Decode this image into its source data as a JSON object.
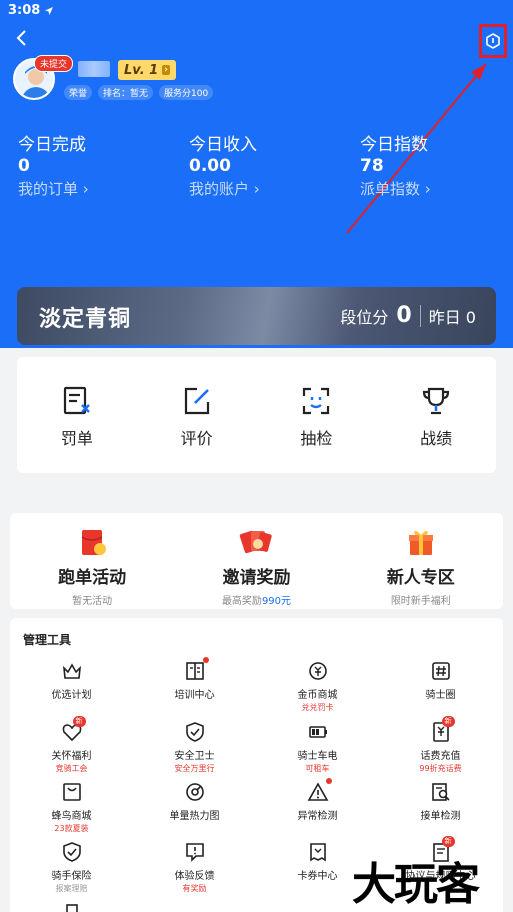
{
  "status_bar": {
    "time": "3:08"
  },
  "profile": {
    "badge": "未提交",
    "level": "Lv. 1",
    "meta": [
      "荣誉",
      "排名：暂无",
      "服务分100"
    ]
  },
  "stats": [
    {
      "label": "今日完成",
      "value": "0",
      "link": "我的订单 ›"
    },
    {
      "label": "今日收入",
      "value": "0.00",
      "link": "我的账户 ›"
    },
    {
      "label": "今日指数",
      "value": "78",
      "link": "派单指数 ›"
    }
  ],
  "rank": {
    "title": "淡定青铜",
    "score_label": "段位分",
    "score": "0",
    "yesterday": "昨日 0"
  },
  "quick_actions": [
    {
      "label": "罚单",
      "icon": "ticket-icon"
    },
    {
      "label": "评价",
      "icon": "edit-icon"
    },
    {
      "label": "抽检",
      "icon": "scan-face-icon"
    },
    {
      "label": "战绩",
      "icon": "trophy-icon"
    }
  ],
  "promos": [
    {
      "title": "跑单活动",
      "sub": "暂无活动",
      "icon": "red-packet-icon"
    },
    {
      "title": "邀请奖励",
      "sub_prefix": "最高奖励",
      "sub_highlight": "990元",
      "icon": "cards-icon"
    },
    {
      "title": "新人专区",
      "sub": "限时新手福利",
      "icon": "gift-icon"
    }
  ],
  "tools": {
    "title": "管理工具",
    "items": [
      {
        "name": "优选计划",
        "sub": "",
        "icon": "crown-icon"
      },
      {
        "name": "培训中心",
        "sub": "",
        "icon": "book-icon",
        "dot": true
      },
      {
        "name": "金币商城",
        "sub": "兑兑罚卡",
        "icon": "coin-icon"
      },
      {
        "name": "骑士圈",
        "sub": "",
        "icon": "hash-icon"
      },
      {
        "name": "关怀福利",
        "sub": "竞骑工会",
        "icon": "heart-icon",
        "badge": "新"
      },
      {
        "name": "安全卫士",
        "sub": "安全万里行",
        "icon": "shield-icon"
      },
      {
        "name": "骑士车电",
        "sub": "可租车",
        "icon": "battery-icon"
      },
      {
        "name": "话费充值",
        "sub": "99折充话费",
        "icon": "phone-bill-icon",
        "badge": "新"
      },
      {
        "name": "蜂鸟商城",
        "sub": "23款夏装",
        "icon": "shop-icon"
      },
      {
        "name": "单量热力图",
        "sub": "",
        "icon": "heatmap-icon"
      },
      {
        "name": "异常检测",
        "sub": "",
        "icon": "warning-icon",
        "dot": true
      },
      {
        "name": "接单检测",
        "sub": "",
        "icon": "search-doc-icon"
      },
      {
        "name": "骑手保险",
        "sub": "报案理赔",
        "sub_gray": true,
        "icon": "insurance-icon"
      },
      {
        "name": "体验反馈",
        "sub": "有奖励",
        "icon": "feedback-icon"
      },
      {
        "name": "卡券中心",
        "sub": "",
        "icon": "coupon-icon"
      },
      {
        "name": "协议与规则中心",
        "sub": "",
        "icon": "rules-icon",
        "badge": "新"
      }
    ]
  },
  "watermark": "大玩客"
}
